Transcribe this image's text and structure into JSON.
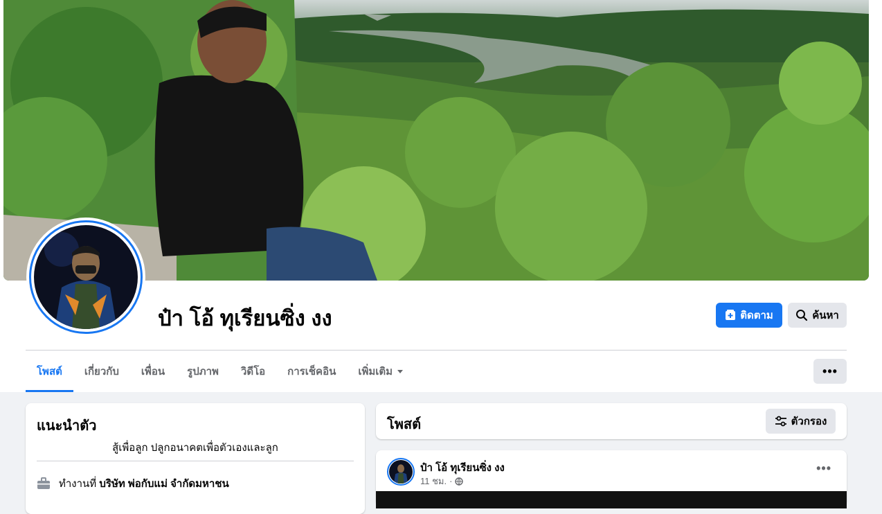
{
  "profile": {
    "name": "ป๋า โอ้ ทุเรียนซิ่ง งง",
    "follow_label": "ติดตาม",
    "search_label": "ค้นหา"
  },
  "tabs": [
    {
      "label": "โพสต์"
    },
    {
      "label": "เกี่ยวกับ"
    },
    {
      "label": "เพื่อน"
    },
    {
      "label": "รูปภาพ"
    },
    {
      "label": "วิดีโอ"
    },
    {
      "label": "การเช็คอิน"
    },
    {
      "label": "เพิ่มเติม"
    }
  ],
  "tabs_more_button": "•••",
  "intro": {
    "title": "แนะนำตัว",
    "bio": "สู้เพื่อลูก ปลูกอนาคตเพื่อตัวเองและลูก",
    "work_prefix": "ทำงานที่",
    "work_place": "บริษัท พ่อกับแม่ จำกัดมหาชน"
  },
  "posts": {
    "title": "โพสต์",
    "filter_label": "ตัวกรอง"
  },
  "post": {
    "author": "ป๋า โอ้ ทุเรียนซิ่ง งง",
    "time": "11 ชม.",
    "separator": "·",
    "more": "•••"
  },
  "colors": {
    "accent": "#1877f2",
    "background": "#f0f2f5",
    "secondary_button": "#e4e6eb"
  },
  "icons": {
    "follow": "add-friend-icon",
    "search": "search-icon",
    "filter": "filter-icon",
    "work": "briefcase-icon",
    "privacy": "globe-icon",
    "dropdown": "caret-down-icon"
  }
}
